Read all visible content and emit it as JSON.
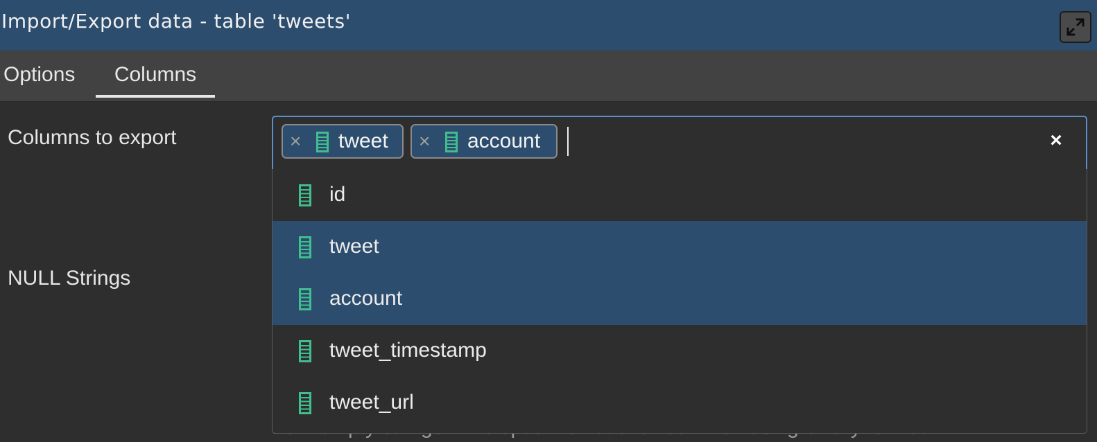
{
  "window": {
    "title": "Import/Export data - table 'tweets'",
    "maximize_icon": "expand-arrows-icon"
  },
  "tabs": [
    {
      "label": "Options",
      "active": false
    },
    {
      "label": "Columns",
      "active": true
    }
  ],
  "form": {
    "columns_label": "Columns to export",
    "null_strings_label": "NULL Strings",
    "columns_select": {
      "selected_chips": [
        {
          "label": "tweet",
          "icon": "column-icon",
          "remove_glyph": "×"
        },
        {
          "label": "account",
          "icon": "column-icon",
          "remove_glyph": "×"
        }
      ],
      "clear_glyph": "×",
      "options": [
        {
          "label": "id",
          "icon": "column-icon",
          "selected": false
        },
        {
          "label": "tweet",
          "icon": "column-icon",
          "selected": true
        },
        {
          "label": "account",
          "icon": "column-icon",
          "selected": true
        },
        {
          "label": "tweet_timestamp",
          "icon": "column-icon",
          "selected": false
        },
        {
          "label": "tweet_url",
          "icon": "column-icon",
          "selected": false
        }
      ]
    },
    "null_strings_help_partial": "from empty strings. This option is not allowed when using binary format."
  },
  "colors": {
    "title_bar": "#2c4d6e",
    "selected_option": "#2c4d6e",
    "focus_border": "#5b8fc7",
    "column_icon": "#3fbf8f"
  }
}
